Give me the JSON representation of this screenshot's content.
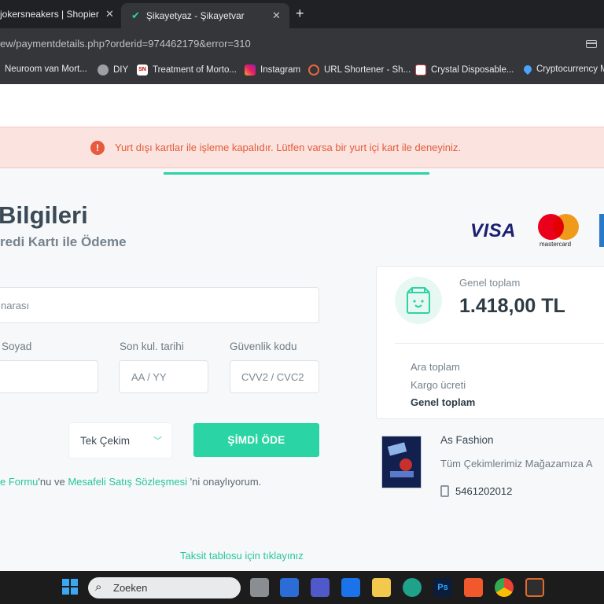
{
  "browser": {
    "tabs": [
      {
        "title": "jokersneakers | Shopier"
      },
      {
        "title": "Şikayetyaz - Şikayetvar"
      }
    ],
    "url": "ew/paymentdetails.php?orderid=974462179&error=310",
    "bookmarks": [
      {
        "label": "Neuroom van Mort..."
      },
      {
        "label": "DIY"
      },
      {
        "label": "Treatment of Morto..."
      },
      {
        "label": "Instagram"
      },
      {
        "label": "URL Shortener - Sh..."
      },
      {
        "label": "Crystal Disposable..."
      },
      {
        "label": "Cryptocurrency M"
      }
    ]
  },
  "alert": {
    "message": "Yurt dışı kartlar ile işleme kapalıdır. Lütfen varsa bir yurt içi kart ile deneyiniz.",
    "icon": "!"
  },
  "payment": {
    "title": "Bilgileri",
    "subtitle": "redi Kartı ile Ödeme",
    "brands": {
      "visa": "VISA",
      "mastercard": "mastercard"
    },
    "card_number_placeholder": "narası",
    "name_label": "Soyad",
    "expiry_label": "Son kul. tarihi",
    "expiry_placeholder": "AA / YY",
    "cvv_label": "Güvenlik kodu",
    "cvv_placeholder": "CVV2 / CVC2",
    "installment_value": "Tek Çekim",
    "pay_button": "ŞİMDİ ÖDE",
    "consent": {
      "link1": "e Formu",
      "mid": "'nu ve ",
      "link2": "Mesafeli Satış Sözleşmesi",
      "end": " 'ni onaylıyorum."
    },
    "installment_table_link": "Taksit tablosu için tıklayınız"
  },
  "summary": {
    "total_label": "Genel toplam",
    "total_value": "1.418,00 TL",
    "rows": [
      "Ara toplam",
      "Kargo ücreti",
      "Genel toplam"
    ]
  },
  "store": {
    "name": "As Fashion",
    "subtitle": "Tüm Çekimlerimiz Mağazamıza A",
    "phone": "5461202012"
  },
  "taskbar": {
    "search_placeholder": "Zoeken"
  },
  "colors": {
    "accent": "#2bd4a4",
    "alert_bg": "#fbe3df",
    "alert_text": "#e35b38"
  }
}
